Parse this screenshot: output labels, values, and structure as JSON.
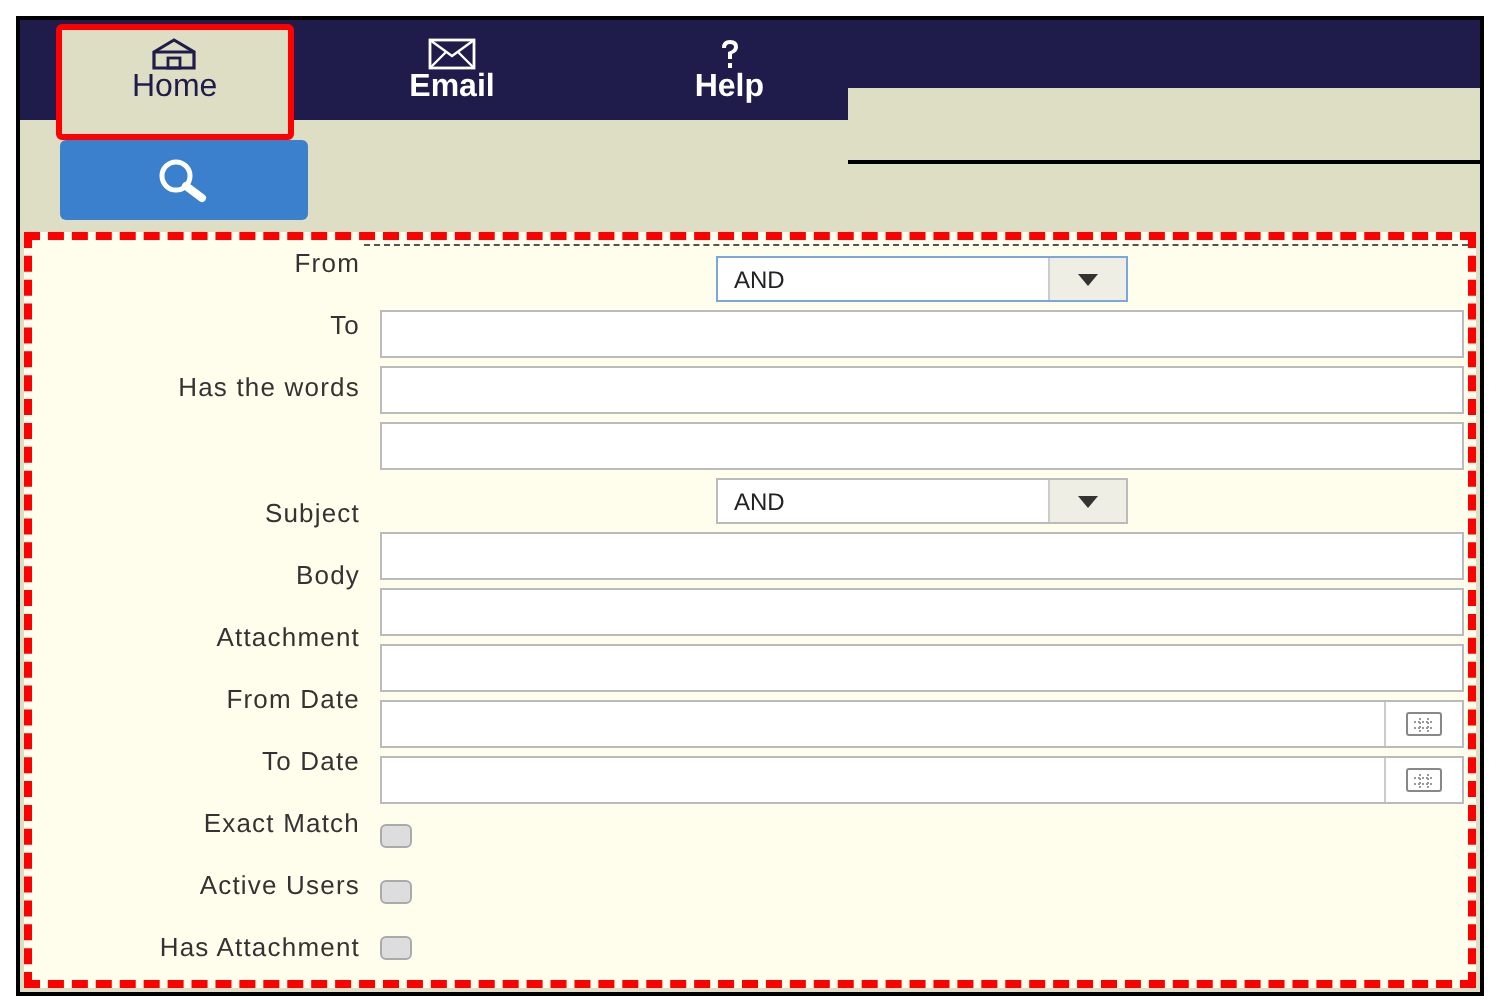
{
  "tabs": [
    {
      "label": "Home",
      "kind": "house",
      "selected": true
    },
    {
      "label": "Email",
      "kind": "envelope",
      "selected": false
    },
    {
      "label": "Help",
      "kind": "question",
      "selected": false
    }
  ],
  "form": {
    "fields": [
      {
        "label": "From",
        "kind": "select",
        "value": "AND",
        "focused": true
      },
      {
        "label": "To",
        "kind": "text"
      },
      {
        "label": "Has the words",
        "kind": "text"
      },
      {
        "kind": "text"
      },
      {
        "label": "Subject",
        "kind": "select",
        "value": "AND",
        "focused": false
      },
      {
        "label": "Body",
        "kind": "text"
      },
      {
        "label": "Attachment",
        "kind": "text"
      },
      {
        "kind": "text"
      },
      {
        "label": "From Date",
        "kind": "date"
      },
      {
        "label": "To Date",
        "kind": "date"
      },
      {
        "label": "Exact Match",
        "kind": "checkbox",
        "checked": false
      },
      {
        "label": "Active Users",
        "kind": "checkbox",
        "checked": false
      },
      {
        "label": "Has Attachment",
        "kind": "checkbox",
        "checked": false
      }
    ]
  }
}
